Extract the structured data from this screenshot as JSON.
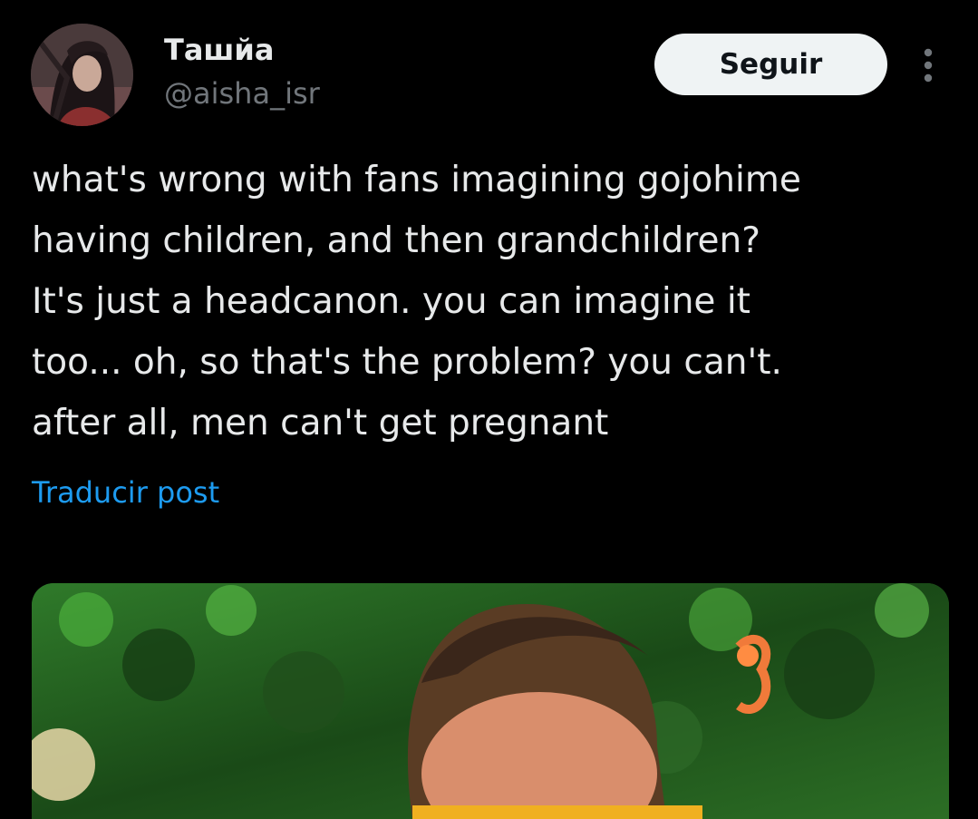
{
  "post": {
    "author": {
      "display_name": "Ташйа",
      "handle": "@aisha_isr",
      "avatar_icon": "profile-avatar"
    },
    "follow_label": "Seguir",
    "more_icon": "more-vertical-icon",
    "text": "what's wrong with fans imagining gojohime\nhaving children, and then grandchildren?\nIt's just a headcanon. you can imagine it\ntoo... oh, so that's the problem? you can't.\nafter all, men can't get pregnant",
    "translate_label": "Traducir post",
    "media": {
      "type": "photo"
    }
  },
  "colors": {
    "background": "#000000",
    "text_primary": "#e7e9ea",
    "text_secondary": "#71767b",
    "link": "#1d9bf0",
    "button_bg": "#eff3f4",
    "button_text": "#0f1419"
  }
}
